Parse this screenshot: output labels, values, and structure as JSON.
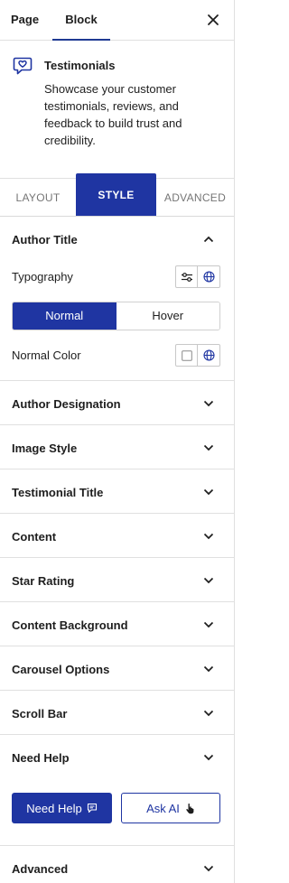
{
  "tabs": {
    "page": "Page",
    "block": "Block"
  },
  "block_card": {
    "title": "Testimonials",
    "description": "Showcase your customer testimonials, reviews, and feedback to build trust and credibility."
  },
  "style_tabs": {
    "layout": "LAYOUT",
    "style": "STYLE",
    "advanced": "ADVANCED",
    "active": "STYLE"
  },
  "author_title": {
    "heading": "Author Title",
    "typography_label": "Typography",
    "state_toggle": {
      "normal": "Normal",
      "hover": "Hover",
      "selected": "Normal"
    },
    "normal_color_label": "Normal Color"
  },
  "sections": [
    "Author Designation",
    "Image Style",
    "Testimonial Title",
    "Content",
    "Star Rating",
    "Content Background",
    "Carousel Options",
    "Scroll Bar",
    "Need Help"
  ],
  "help_buttons": {
    "need_help": "Need Help",
    "ask_ai": "Ask AI"
  },
  "advanced_section": "Advanced",
  "colors": {
    "accent": "#1f35a2",
    "divider": "#e0e0e0"
  }
}
